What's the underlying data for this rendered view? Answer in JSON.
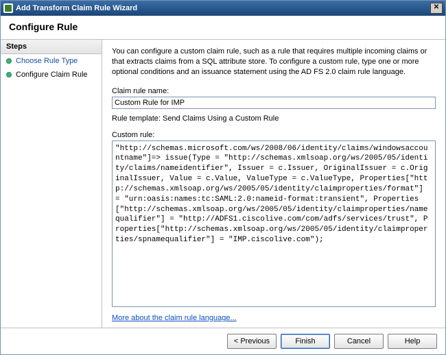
{
  "window": {
    "title": "Add Transform Claim Rule Wizard"
  },
  "header": {
    "title": "Configure Rule"
  },
  "sidebar": {
    "title": "Steps",
    "items": [
      {
        "label": "Choose Rule Type"
      },
      {
        "label": "Configure Claim Rule"
      }
    ]
  },
  "main": {
    "description": "You can configure a custom claim rule, such as a rule that requires multiple incoming claims or that extracts claims from a SQL attribute store. To configure a custom rule, type one or more optional conditions and an issuance statement using the AD FS 2.0 claim rule language.",
    "rule_name_label": "Claim rule name:",
    "rule_name_value": "Custom Rule for IMP",
    "template_label": "Rule template: Send Claims Using a Custom Rule",
    "custom_rule_label": "Custom rule:",
    "custom_rule_value": "\"http://schemas.microsoft.com/ws/2008/06/identity/claims/windowsaccountname\"]=> issue(Type = \"http://schemas.xmlsoap.org/ws/2005/05/identity/claims/nameidentifier\", Issuer = c.Issuer, OriginalIssuer = c.OriginalIssuer, Value = c.Value, ValueType = c.ValueType, Properties[\"http://schemas.xmlsoap.org/ws/2005/05/identity/claimproperties/format\"] = \"urn:oasis:names:tc:SAML:2.0:nameid-format:transient\", Properties[\"http://schemas.xmlsoap.org/ws/2005/05/identity/claimproperties/namequalifier\"] = \"http://ADFS1.ciscolive.com/com/adfs/services/trust\", Properties[\"http://schemas.xmlsoap.org/ws/2005/05/identity/claimproperties/spnamequalifier\"] = \"IMP.ciscolive.com\");",
    "link_label": "More about the claim rule language..."
  },
  "footer": {
    "previous": "< Previous",
    "finish": "Finish",
    "cancel": "Cancel",
    "help": "Help"
  }
}
